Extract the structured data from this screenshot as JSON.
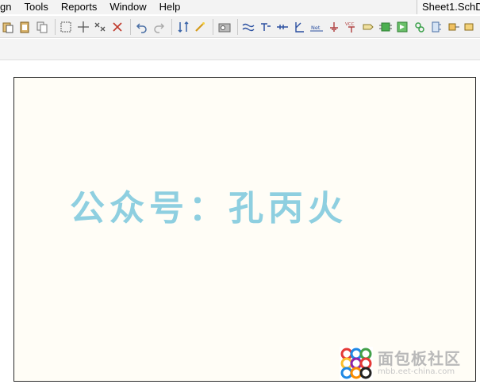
{
  "menubar": {
    "items": [
      "gn",
      "Tools",
      "Reports",
      "Window",
      "Help"
    ],
    "document_tab": "Sheet1.SchD"
  },
  "toolbar": {
    "groups": [
      [
        "paste-icon",
        "clipboard-icon",
        "copy-icon"
      ],
      [
        "select-rectangle-icon",
        "move-icon",
        "deselect-icon",
        "clear-selection-icon"
      ],
      [
        "undo-icon",
        "redo-icon"
      ],
      [
        "hierarchy-icon",
        "wand-icon"
      ],
      [
        "browse-icon"
      ],
      [
        "wire-icon",
        "bus-icon",
        "bus-entry-icon",
        "junction-icon",
        "net-label-icon",
        "ground-icon",
        "vcc-power-icon",
        "port-icon",
        "part-icon",
        "sheet-symbol-icon",
        "sheet-entry-icon",
        "power-port-icon",
        "place-port-icon",
        "more-icon"
      ]
    ],
    "net_label": "Net",
    "vcc_label": "VCC"
  },
  "sheet": {
    "title_text": "公众号：孔丙火"
  },
  "logo": {
    "title": "面包板社区",
    "url": "mbb.eet-china.com"
  },
  "colors": {
    "sheet_bg": "#fffdf6",
    "title_color": "#8ecfe0"
  }
}
